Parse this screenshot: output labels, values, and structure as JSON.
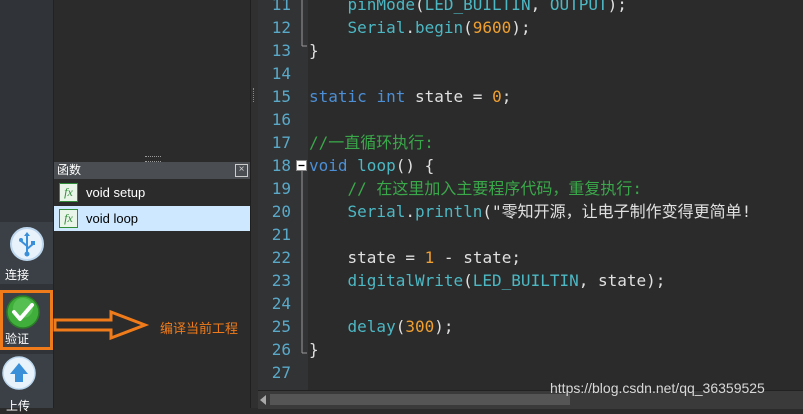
{
  "toolbar": {
    "connect_label": "连接",
    "verify_label": "验证",
    "upload_label": "上传"
  },
  "function_panel": {
    "title": "函数",
    "items": [
      {
        "label": "void setup",
        "selected": false
      },
      {
        "label": "void loop",
        "selected": true
      }
    ]
  },
  "annotation": {
    "text": "编译当前工程",
    "color": "#f07b1a"
  },
  "editor": {
    "line_numbers": [
      "11",
      "12",
      "13",
      "14",
      "15",
      "16",
      "17",
      "18",
      "19",
      "20",
      "21",
      "22",
      "23",
      "24",
      "25",
      "26",
      "27"
    ]
  },
  "watermark": "https://blog.csdn.net/qq_36359525"
}
